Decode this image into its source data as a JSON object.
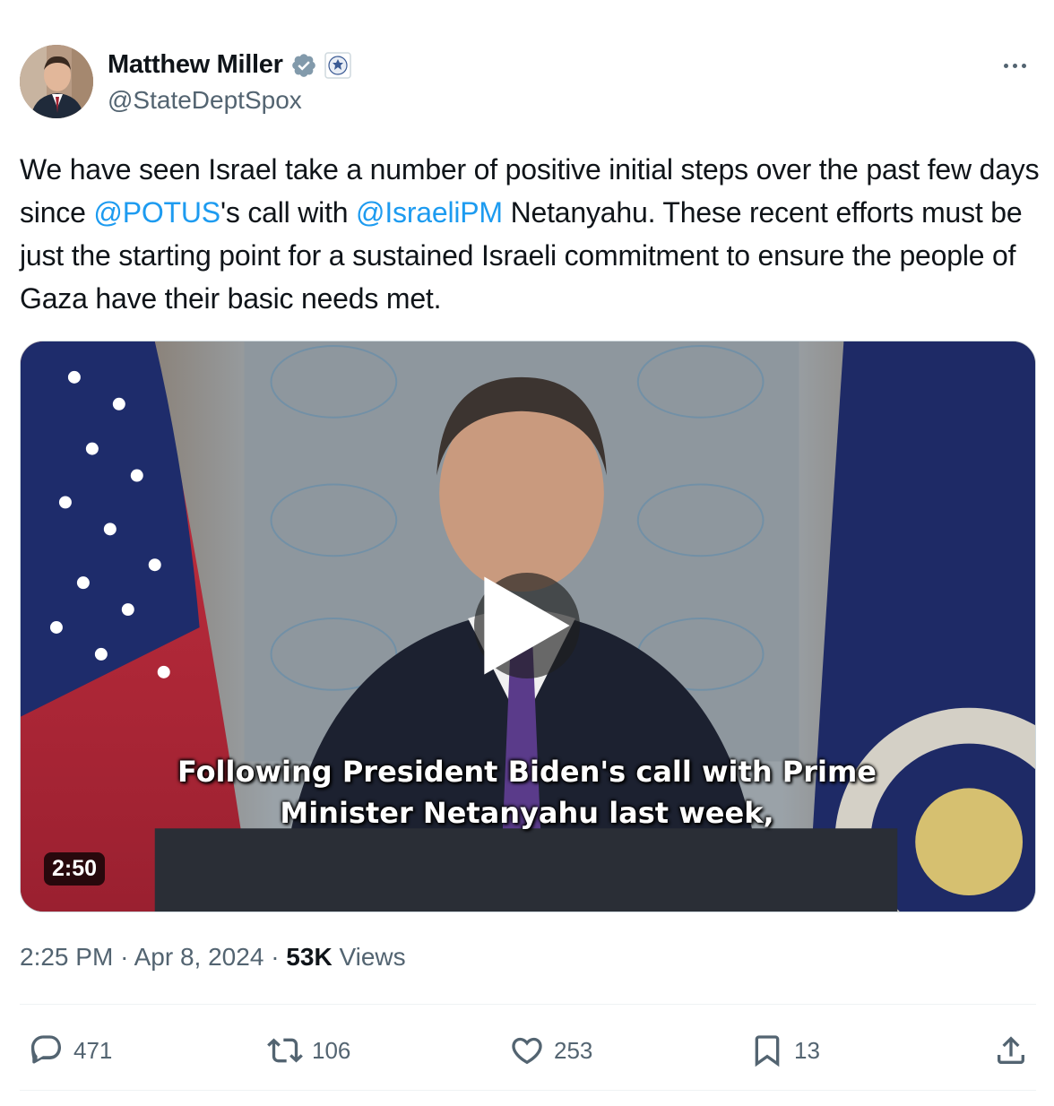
{
  "author": {
    "display_name": "Matthew Miller",
    "handle": "@StateDeptSpox",
    "verified": true
  },
  "tweet": {
    "text_parts": [
      "We have seen Israel take a number of positive initial steps over the past few days since ",
      "@POTUS",
      "'s call with ",
      "@IsraeliPM",
      " Netanyahu. These recent efforts must be just the starting point for a sustained Israeli commitment to ensure the people of Gaza have their basic needs met."
    ]
  },
  "media": {
    "duration": "2:50",
    "caption_line1": "Following President Biden's call with Prime",
    "caption_line2": "Minister Netanyahu last week,"
  },
  "meta": {
    "time": "2:25 PM",
    "separator": "·",
    "date": "Apr 8, 2024",
    "views_count": "53K",
    "views_label": "Views"
  },
  "actions": {
    "replies": "471",
    "reposts": "106",
    "likes": "253",
    "bookmarks": "13"
  },
  "colors": {
    "accent": "#1d9bf0",
    "secondary_text": "#536471",
    "primary_text": "#0f1419"
  }
}
